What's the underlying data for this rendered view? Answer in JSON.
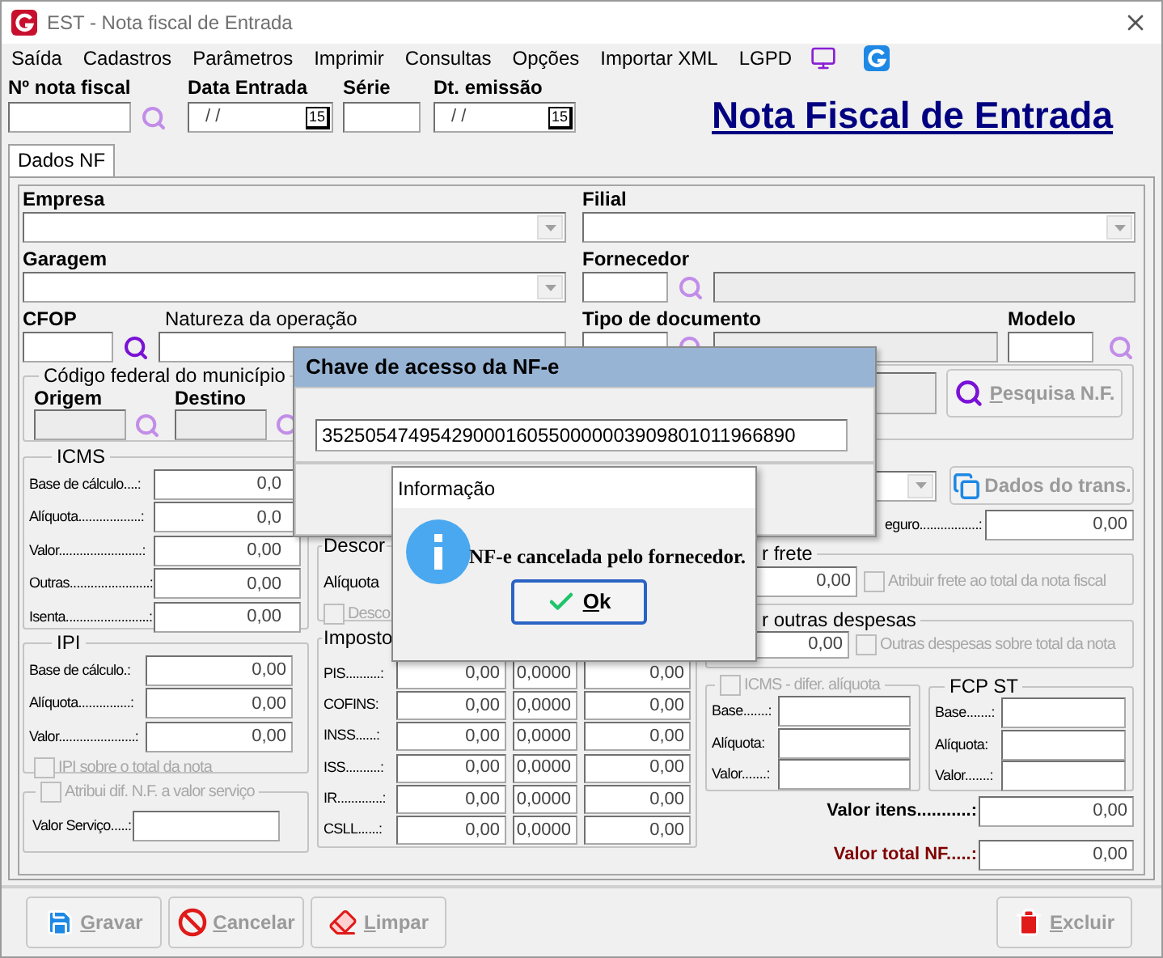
{
  "window": {
    "title": "EST - Nota fiscal de Entrada"
  },
  "menu": [
    {
      "label": "Saída"
    },
    {
      "label": "Cadastros"
    },
    {
      "label": "Parâmetros"
    },
    {
      "label": "Imprimir"
    },
    {
      "label": "Consultas"
    },
    {
      "label": "Opções"
    },
    {
      "label": "Importar XML"
    },
    {
      "label": "LGPD"
    }
  ],
  "header": {
    "nota_fiscal": {
      "label": "Nº nota fiscal"
    },
    "data_entrada": {
      "label": "Data Entrada",
      "value": "/ /",
      "calendar": "15"
    },
    "serie": {
      "label": "Série"
    },
    "dt_emissao": {
      "label": "Dt. emissão",
      "value": "/ /",
      "calendar": "15"
    },
    "title": "Nota Fiscal de Entrada"
  },
  "tabs": [
    {
      "label": "Dados NF",
      "selected": true
    }
  ],
  "empresa": {
    "label": "Empresa"
  },
  "filial": {
    "label": "Filial"
  },
  "garagem": {
    "label": "Garagem"
  },
  "fornecedor": {
    "label": "Fornecedor",
    "description_disabled": true
  },
  "cfop": {
    "label": "CFOP"
  },
  "natureza": {
    "label": "Natureza da operação"
  },
  "tipo_documento": {
    "label": "Tipo de documento",
    "description_disabled": true
  },
  "modelo": {
    "label": "Modelo"
  },
  "municipio": {
    "title": "Código federal do município",
    "origem": {
      "label": "Origem",
      "disabled": true
    },
    "destino": {
      "label": "Destino",
      "disabled": true
    }
  },
  "icms": {
    "title": "ICMS",
    "rows": [
      {
        "label": "Base de cálculo....:",
        "value": "0,0"
      },
      {
        "label": "Alíquota..................:",
        "value": "0,0"
      },
      {
        "label": "Valor........................:",
        "value": "0,00"
      },
      {
        "label": "Outras.......................:",
        "value": "0,00"
      },
      {
        "label": "Isenta........................:",
        "value": "0,00"
      }
    ]
  },
  "ipi": {
    "title": "IPI",
    "rows": [
      {
        "label": "Base de cálculo.:",
        "value": "0,00"
      },
      {
        "label": "Alíquota...............:",
        "value": "0,00"
      },
      {
        "label": "Valor......................:",
        "value": "0,00"
      }
    ],
    "checkbox": {
      "label": "IPI sobre o total da nota",
      "checked": false,
      "disabled": true
    }
  },
  "servico": {
    "checkbox": {
      "label": "Atribui dif. N.F. a valor serviço",
      "checked": false,
      "disabled": true
    },
    "label": "Valor Serviço.....:"
  },
  "desconto": {
    "title": "Descor",
    "label": "Alíquota",
    "checkbox": {
      "label": "Desco",
      "checked": false,
      "disabled": true
    }
  },
  "impostos": {
    "title": "Imposto",
    "rows": [
      {
        "label": "PIS..........:",
        "values": [
          "0,00",
          "0,0000",
          "0,00"
        ]
      },
      {
        "label": "COFINS:",
        "values": [
          "0,00",
          "0,0000",
          "0,00"
        ]
      },
      {
        "label": "INSS......:",
        "values": [
          "0,00",
          "0,0000",
          "0,00"
        ]
      },
      {
        "label": "ISS..........:",
        "values": [
          "0,00",
          "0,0000",
          "0,00"
        ]
      },
      {
        "label": "IR.............:",
        "values": [
          "0,00",
          "0,0000",
          "0,00"
        ]
      },
      {
        "label": "CSLL......:",
        "values": [
          "0,00",
          "0,0000",
          "0,00"
        ]
      }
    ]
  },
  "pesquisa": {
    "field_disabled": true,
    "button": {
      "label": "Pesquisa N.F.",
      "disabled": true
    }
  },
  "transporte_button": {
    "label": "Dados do trans.",
    "disabled": true
  },
  "seguro": {
    "label": "eguro.................:",
    "value": "0,00"
  },
  "frete": {
    "title": "r frete",
    "value": "0,00",
    "checkbox": {
      "label": "Atribuir frete ao total da nota fiscal",
      "checked": false,
      "disabled": true
    }
  },
  "outras": {
    "title": "r outras despesas",
    "value": "0,00",
    "checkbox": {
      "label": "Outras despesas sobre total da nota",
      "checked": false,
      "disabled": true
    }
  },
  "icms_difer": {
    "checkbox": {
      "label": "ICMS - difer. alíquota",
      "checked": false,
      "disabled": true
    },
    "rows": [
      {
        "label": "Base.......:"
      },
      {
        "label": "Alíquota:"
      },
      {
        "label": "Valor.......:"
      }
    ]
  },
  "fcp_st": {
    "title": "FCP ST",
    "rows": [
      {
        "label": "Base.......:"
      },
      {
        "label": "Alíquota:"
      },
      {
        "label": "Valor.......:"
      }
    ]
  },
  "totals": [
    {
      "label": "Valor itens...........:",
      "value": "0,00",
      "kind": "items"
    },
    {
      "label": "Valor total NF.....:",
      "value": "0,00",
      "kind": "total"
    }
  ],
  "buttons": [
    {
      "label": "Gravar",
      "kind": "save",
      "disabled": true
    },
    {
      "label": "Cancelar",
      "kind": "cancel",
      "disabled": true
    },
    {
      "label": "Limpar",
      "kind": "clear",
      "disabled": true
    },
    {
      "label": "Excluir",
      "kind": "delete",
      "disabled": true
    }
  ],
  "chave_dialog": {
    "title": "Chave de acesso da NF-e",
    "value": "35250547495429000160550000003909801011966890"
  },
  "info_dialog": {
    "title": "Informação",
    "message": "NF-e cancelada pelo fornecedor.",
    "button": "Ok"
  }
}
